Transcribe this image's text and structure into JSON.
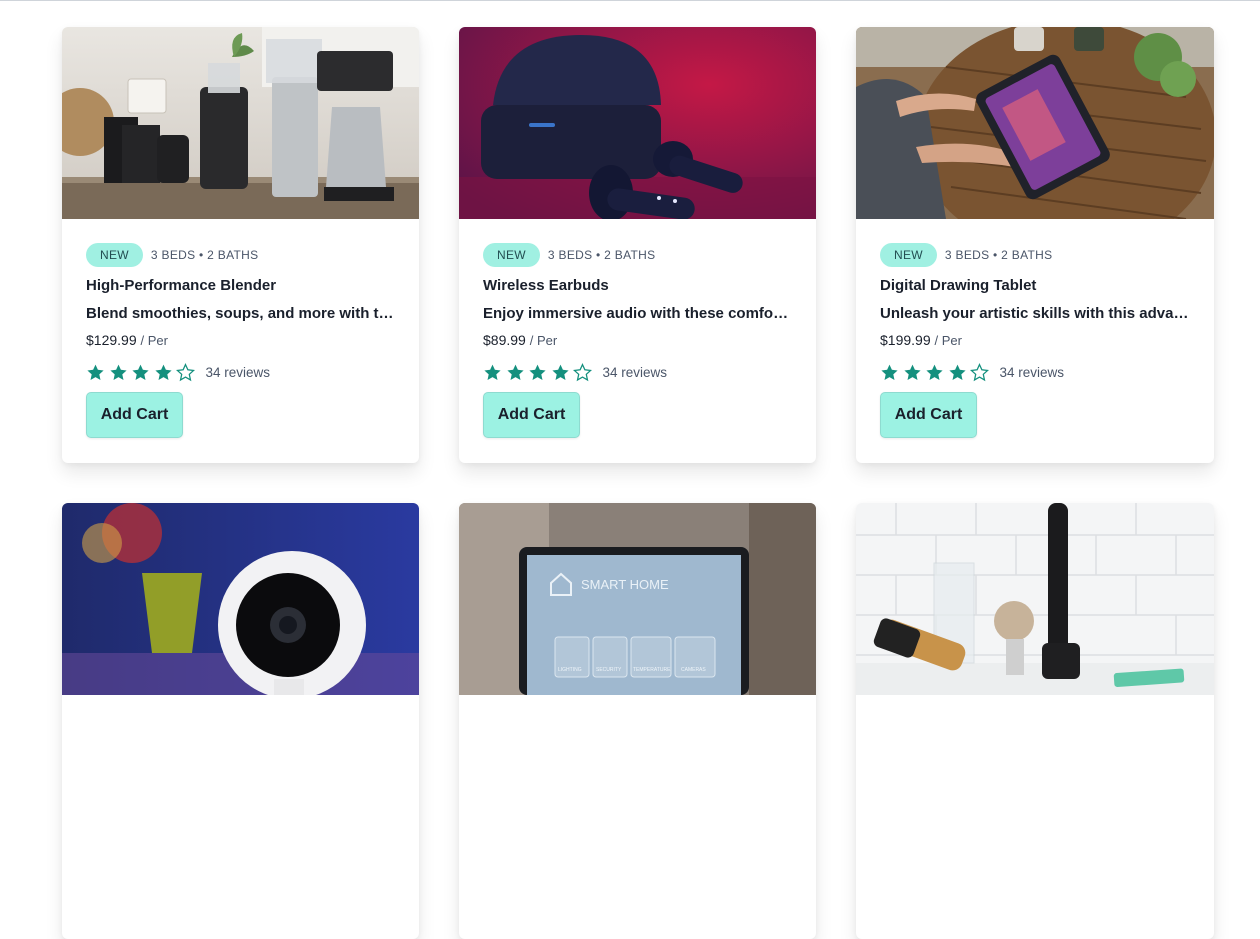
{
  "colors": {
    "accent_badge": "#a0f0e2",
    "star": "#14907e",
    "button": "#9cf2e3"
  },
  "products": [
    {
      "badge": "New",
      "specs": "3 beds • 2 baths",
      "title": "High-Performance Blender",
      "description": "Blend smoothies, soups, and more with this high-performance blender.",
      "price": "$129.99",
      "price_unit": "/ Per",
      "rating": 4,
      "rating_max": 5,
      "reviews": "34 reviews",
      "button_label": "Add Cart",
      "image_icon": "coffee-maker-photo"
    },
    {
      "badge": "New",
      "specs": "3 beds • 2 baths",
      "title": "Wireless Earbuds",
      "description": "Enjoy immersive audio with these comfortable wireless earbuds.",
      "price": "$89.99",
      "price_unit": "/ Per",
      "rating": 4,
      "rating_max": 5,
      "reviews": "34 reviews",
      "button_label": "Add Cart",
      "image_icon": "earbuds-photo"
    },
    {
      "badge": "New",
      "specs": "3 beds • 2 baths",
      "title": "Digital Drawing Tablet",
      "description": "Unleash your artistic skills with this advanced digital drawing tablet.",
      "price": "$199.99",
      "price_unit": "/ Per",
      "rating": 4,
      "rating_max": 5,
      "reviews": "34 reviews",
      "button_label": "Add Cart",
      "image_icon": "drawing-tablet-photo"
    },
    {
      "image_icon": "security-camera-photo"
    },
    {
      "image_icon": "smart-home-tablet-photo",
      "image_text": {
        "heading": "SMART HOME",
        "tiles": [
          "LIGHTING",
          "SECURITY",
          "TEMPERATURE",
          "CAMERAS"
        ]
      }
    },
    {
      "image_icon": "electric-toothbrush-photo"
    }
  ]
}
